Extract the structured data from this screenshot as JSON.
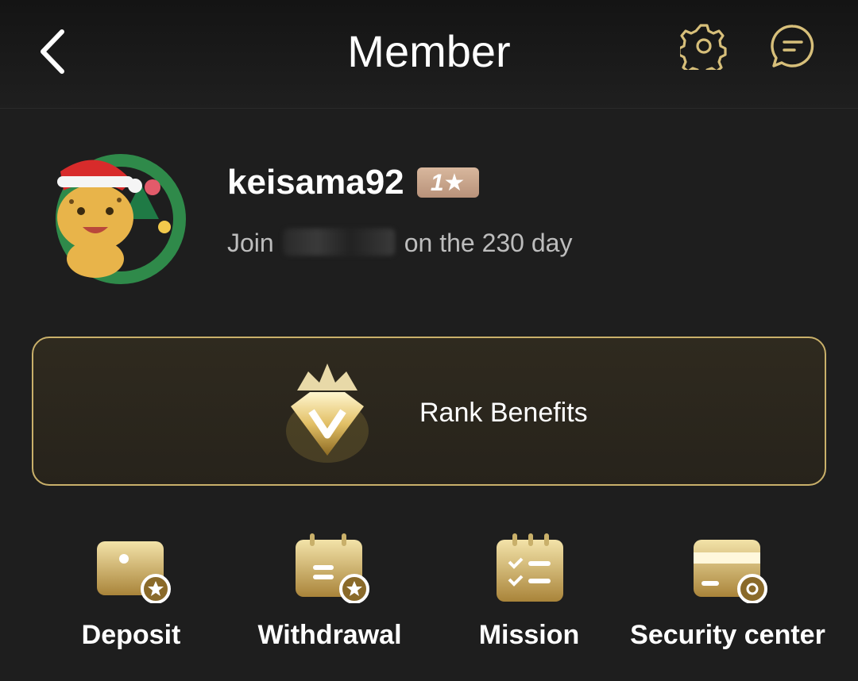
{
  "header": {
    "title": "Member"
  },
  "profile": {
    "username": "keisama92",
    "rank_badge": "1★",
    "join_prefix": "Join",
    "join_suffix": "on the 230 day"
  },
  "rank_card": {
    "label": "Rank Benefits"
  },
  "menu": {
    "items": [
      {
        "label": "Deposit",
        "icon": "wallet-icon"
      },
      {
        "label": "Withdrawal",
        "icon": "calendar-icon"
      },
      {
        "label": "Mission",
        "icon": "checklist-icon"
      },
      {
        "label": "Security center",
        "icon": "card-shield-icon"
      }
    ]
  },
  "colors": {
    "background": "#1e1e1e",
    "gold_accent": "#c9b06a",
    "badge": "#c9a48a"
  }
}
